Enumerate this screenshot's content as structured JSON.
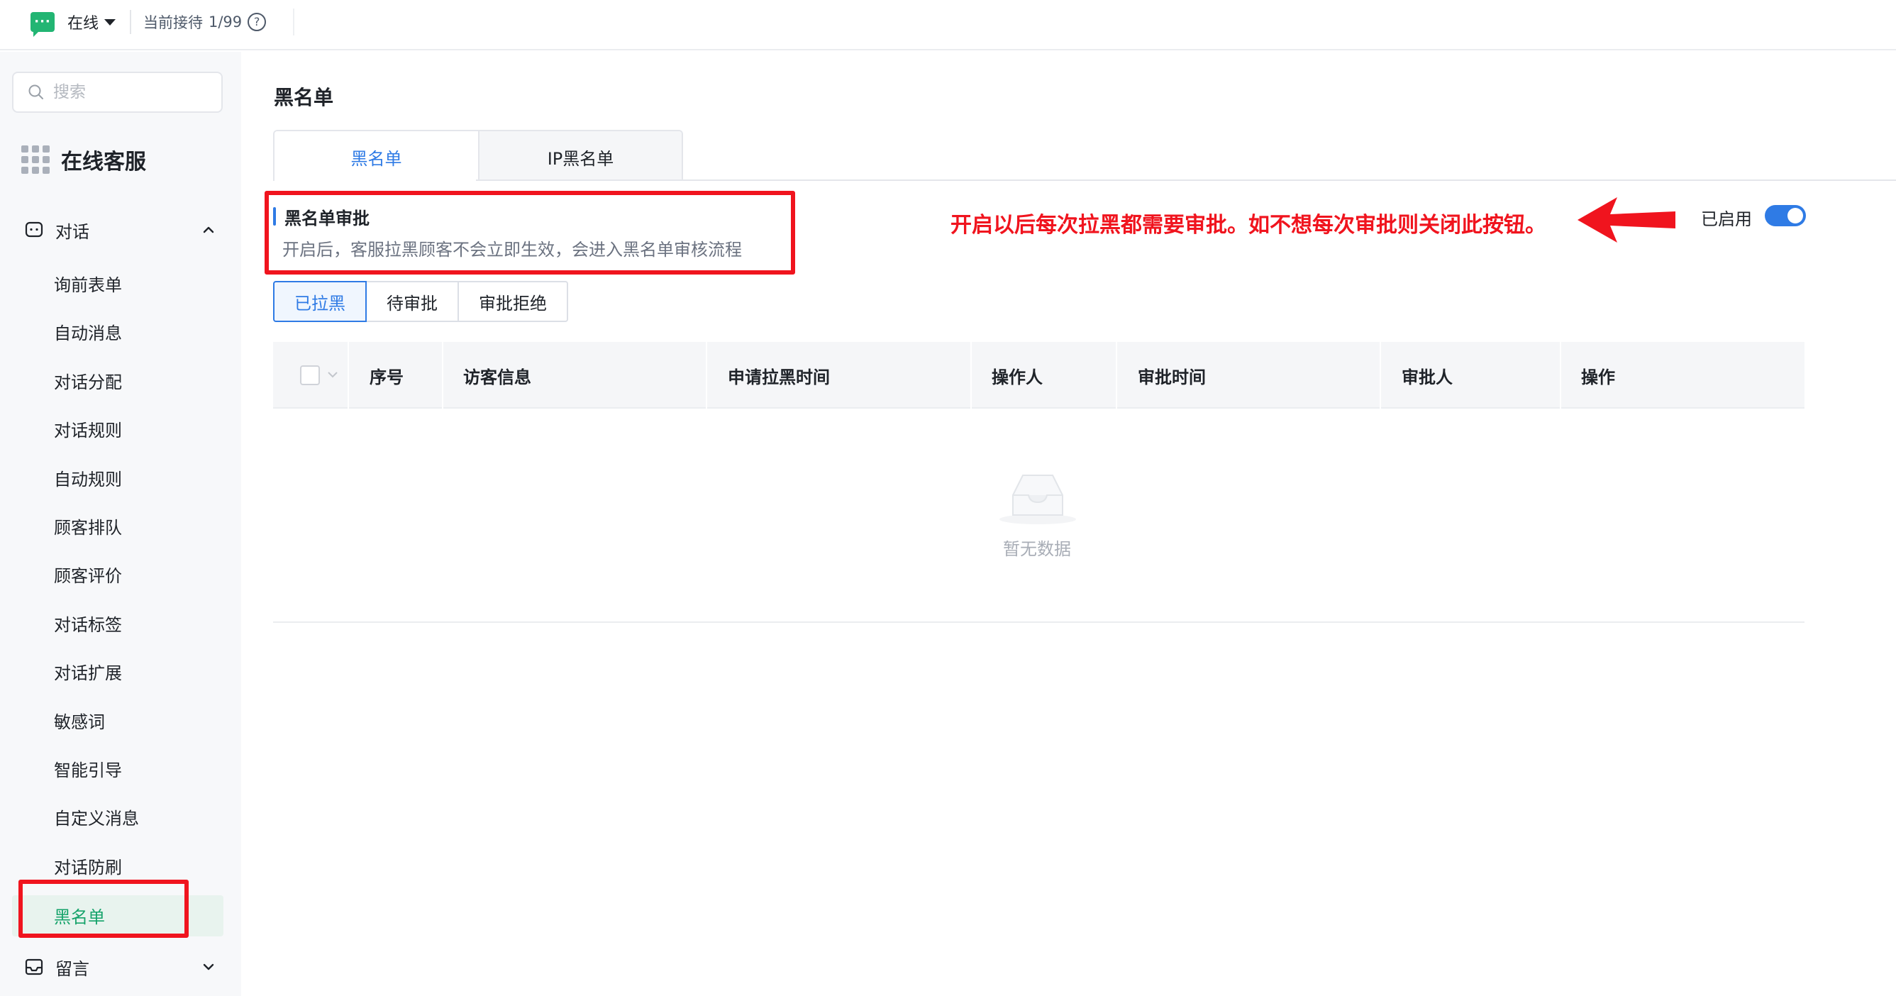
{
  "topbar": {
    "status": "在线",
    "queue_label": "当前接待",
    "queue_value": "1/99",
    "help": "?"
  },
  "sidebar": {
    "search_placeholder": "搜索",
    "app_title": "在线客服",
    "groups": [
      {
        "label": "对话",
        "expanded": true,
        "items": [
          {
            "label": "询前表单"
          },
          {
            "label": "自动消息"
          },
          {
            "label": "对话分配"
          },
          {
            "label": "对话规则"
          },
          {
            "label": "自动规则"
          },
          {
            "label": "顾客排队"
          },
          {
            "label": "顾客评价"
          },
          {
            "label": "对话标签"
          },
          {
            "label": "对话扩展"
          },
          {
            "label": "敏感词"
          },
          {
            "label": "智能引导"
          },
          {
            "label": "自定义消息"
          },
          {
            "label": "对话防刷"
          },
          {
            "label": "黑名单",
            "active": true
          }
        ]
      },
      {
        "label": "留言",
        "expanded": false
      }
    ]
  },
  "main": {
    "page_title": "黑名单",
    "tabs": [
      {
        "label": "黑名单",
        "active": true
      },
      {
        "label": "IP黑名单",
        "active": false
      }
    ],
    "section": {
      "title": "黑名单审批",
      "description": "开启后，客服拉黑顾客不会立即生效，会进入黑名单审核流程"
    },
    "annotation": "开启以后每次拉黑都需要审批。如不想每次审批则关闭此按钮。",
    "toggle": {
      "label": "已启用",
      "on": true
    },
    "subtabs": [
      {
        "label": "已拉黑",
        "active": true
      },
      {
        "label": "待审批",
        "active": false
      },
      {
        "label": "审批拒绝",
        "active": false
      }
    ],
    "table": {
      "columns": [
        "序号",
        "访客信息",
        "申请拉黑时间",
        "操作人",
        "审批时间",
        "审批人",
        "操作"
      ],
      "empty_text": "暂无数据"
    }
  },
  "colors": {
    "accent": "#2f7be5",
    "brand_green": "#22b573",
    "active_menu": "#16a36b",
    "annotation_red": "#f0141e"
  }
}
